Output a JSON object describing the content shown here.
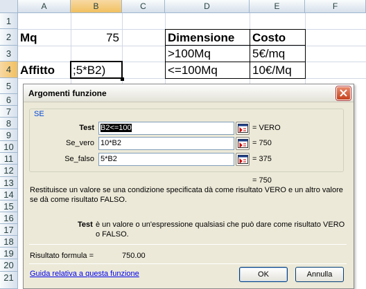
{
  "sheet": {
    "columns": [
      "A",
      "B",
      "C",
      "D",
      "E",
      "F"
    ],
    "rows": [
      "1",
      "2",
      "3",
      "4",
      "5",
      "6",
      "7",
      "8",
      "9",
      "10",
      "11",
      "12",
      "13",
      "14",
      "15",
      "16",
      "17",
      "18",
      "19",
      "20",
      "21"
    ],
    "a2": "Mq",
    "b2": "75",
    "a4": "Affitto",
    "b4": ";5*B2)",
    "d2": "Dimensione",
    "e2": "Costo",
    "d3": ">100Mq",
    "e3": "5€/mq",
    "d4": "<=100Mq",
    "e4": "10€/Mq"
  },
  "dialog": {
    "title": "Argomenti funzione",
    "function_name": "SE",
    "args": [
      {
        "label": "Test",
        "value": "B2<=100",
        "result": "= VERO"
      },
      {
        "label": "Se_vero",
        "value": "10*B2",
        "result": "= 750"
      },
      {
        "label": "Se_falso",
        "value": "5*B2",
        "result": "= 375"
      }
    ],
    "overall_result": "= 750",
    "description": "Restituisce un valore se una condizione specificata dà come risultato VERO e un altro valore se dà come risultato FALSO.",
    "arg_help_name": "Test",
    "arg_help_text": "è un valore o un'espressione qualsiasi che può dare come risultato VERO o FALSO.",
    "formula_result_label": "Risultato formula =",
    "formula_result_value": "750.00",
    "help_link": "Guida relativa a questa funzione",
    "ok_label": "OK",
    "cancel_label": "Annulla"
  }
}
